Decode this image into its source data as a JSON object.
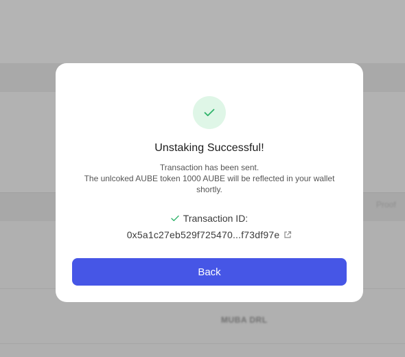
{
  "background": {
    "right_column_text": "Proof",
    "bottom_text": "MUBA DRL"
  },
  "modal": {
    "success_icon": "check-icon",
    "title": "Unstaking Successful!",
    "message_line1": "Transaction has been sent.",
    "message_line2": "The unlcoked AUBE token 1000 AUBE will be reflected in your wallet shortly.",
    "transaction_label": "Transaction ID:",
    "transaction_hash": "0x5a1c27eb529f725470...f73df97e",
    "link_icon": "external-link-icon",
    "back_label": "Back"
  },
  "colors": {
    "accent": "#4656e6",
    "success": "#2fb36a",
    "success_bg": "#dff6e7"
  }
}
